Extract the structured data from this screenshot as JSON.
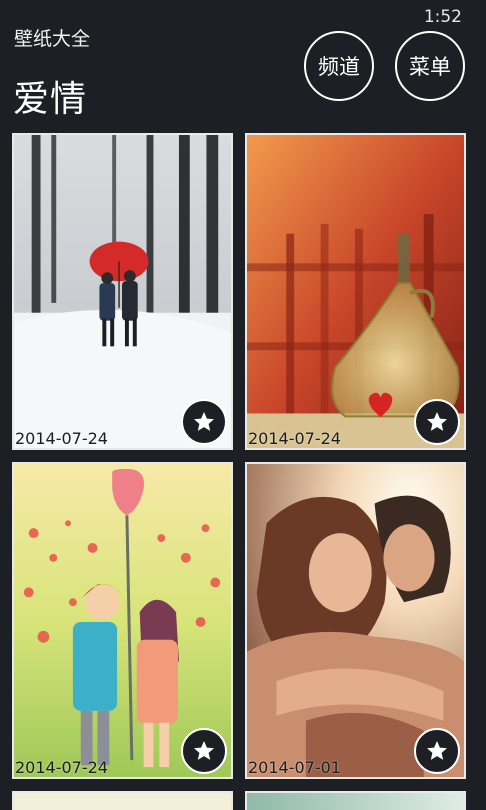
{
  "status": {
    "time": "1:52"
  },
  "app": {
    "title": "壁纸大全"
  },
  "page": {
    "title": "爱情"
  },
  "buttons": {
    "channel": "频道",
    "menu": "菜单"
  },
  "wallpapers": [
    {
      "date": "2014-07-24",
      "subject": "couple-umbrella-snow",
      "favorite_icon": "star-icon"
    },
    {
      "date": "2014-07-24",
      "subject": "glass-bottle-heart",
      "favorite_icon": "star-icon"
    },
    {
      "date": "2014-07-24",
      "subject": "cartoon-couple-love-balloon",
      "favorite_icon": "star-icon"
    },
    {
      "date": "2014-07-01",
      "subject": "couple-embrace",
      "favorite_icon": "star-icon"
    },
    {
      "date": "",
      "subject": "partial"
    },
    {
      "date": "",
      "subject": "partial"
    }
  ]
}
